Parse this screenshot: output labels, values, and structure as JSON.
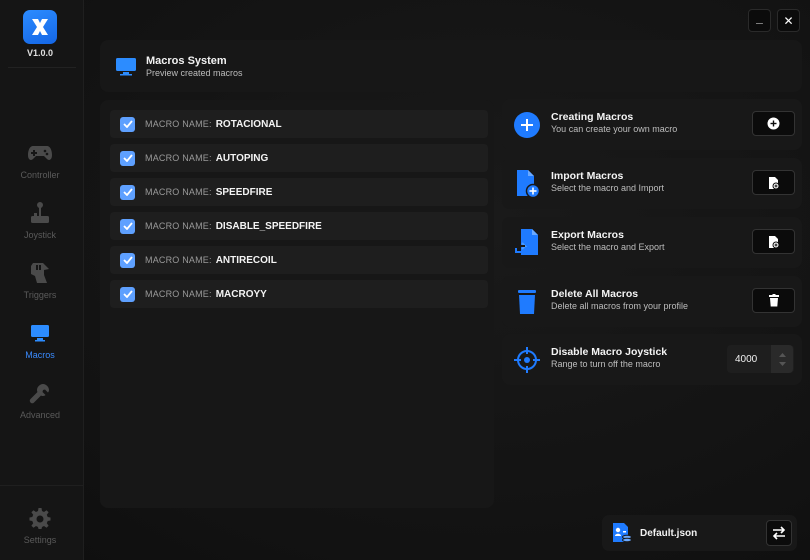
{
  "app": {
    "version": "V1.0.0",
    "accent": "#2c8cff"
  },
  "sidebar": {
    "items": [
      {
        "label": "Controller",
        "icon": "gamepad-icon",
        "active": false
      },
      {
        "label": "Joystick",
        "icon": "joystick-icon",
        "active": false
      },
      {
        "label": "Triggers",
        "icon": "trigger-hand-icon",
        "active": false
      },
      {
        "label": "Macros",
        "icon": "monitor-icon",
        "active": true
      },
      {
        "label": "Advanced",
        "icon": "wrench-icon",
        "active": false
      }
    ],
    "settings_label": "Settings"
  },
  "window": {
    "minimize_symbol": "_",
    "close_symbol": "✕"
  },
  "header": {
    "title": "Macros System",
    "subtitle": "Preview created macros"
  },
  "macros": {
    "prefix": "MACRO NAME:",
    "items": [
      {
        "name": "ROTACIONAL",
        "checked": true
      },
      {
        "name": "AUTOPING",
        "checked": true
      },
      {
        "name": "SPEEDFIRE",
        "checked": true
      },
      {
        "name": "DISABLE_SPEEDFIRE",
        "checked": true
      },
      {
        "name": "ANTIRECOIL",
        "checked": true
      },
      {
        "name": "MACROYY",
        "checked": true
      }
    ]
  },
  "actions": {
    "creating": {
      "title": "Creating Macros",
      "subtitle": "You can create your own macro",
      "icon": "plus-circle-icon"
    },
    "import": {
      "title": "Import Macros",
      "subtitle": "Select the macro and Import",
      "icon": "file-add-icon"
    },
    "export": {
      "title": "Export Macros",
      "subtitle": "Select the macro and Export",
      "icon": "file-export-icon"
    },
    "delete": {
      "title": "Delete All Macros",
      "subtitle": "Delete all macros from your profile",
      "icon": "trash-icon"
    },
    "disable_joystick": {
      "title": "Disable Macro Joystick",
      "subtitle": "Range to turn off the macro",
      "icon": "crosshair-icon",
      "value": "4000"
    }
  },
  "profile": {
    "name": "Default.json"
  }
}
